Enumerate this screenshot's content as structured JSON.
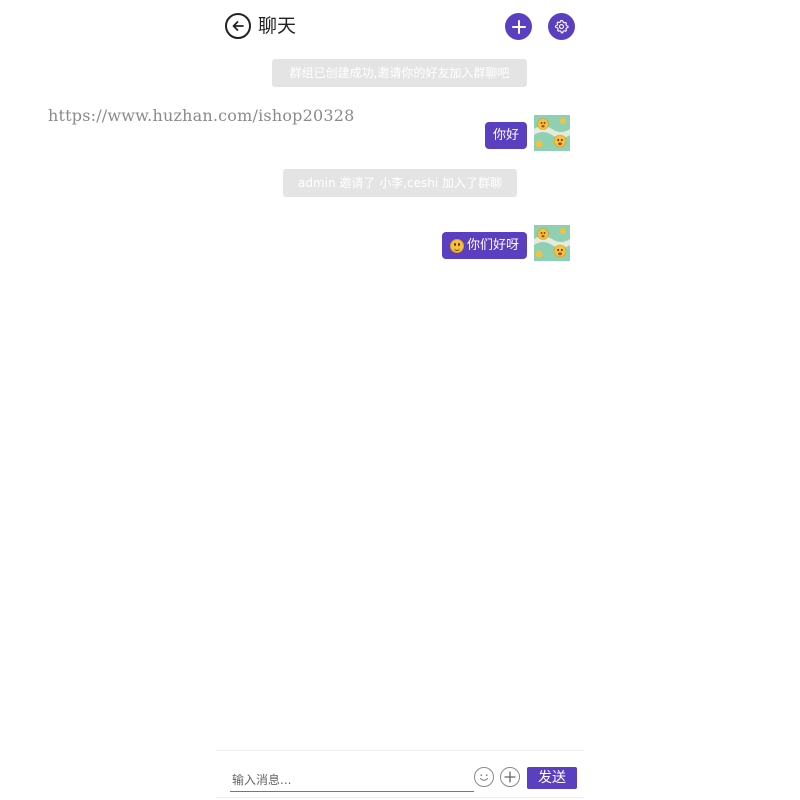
{
  "watermark": "https://www.huzhan.com/ishop20328",
  "header": {
    "title": "聊天",
    "back_icon": "arrow-left-circle-icon",
    "add_icon": "plus-icon",
    "settings_icon": "gear-icon"
  },
  "messages": {
    "system_1": "群组已创建成功,邀请你的好友加入群聊吧",
    "bubble_1": "你好",
    "system_2": "admin 邀请了 小李,ceshi 加入了群聊",
    "bubble_2": "你们好呀",
    "bubble_2_emoji": "smiling-face-icon"
  },
  "composer": {
    "placeholder": "输入消息...",
    "send_label": "发送",
    "emoji_icon": "smiley-icon",
    "plus_icon": "plus-circle-icon"
  },
  "colors": {
    "accent": "#5a3fc0",
    "system_bg": "#e4e4e4",
    "avatar_bg": "#8fd0b2"
  }
}
